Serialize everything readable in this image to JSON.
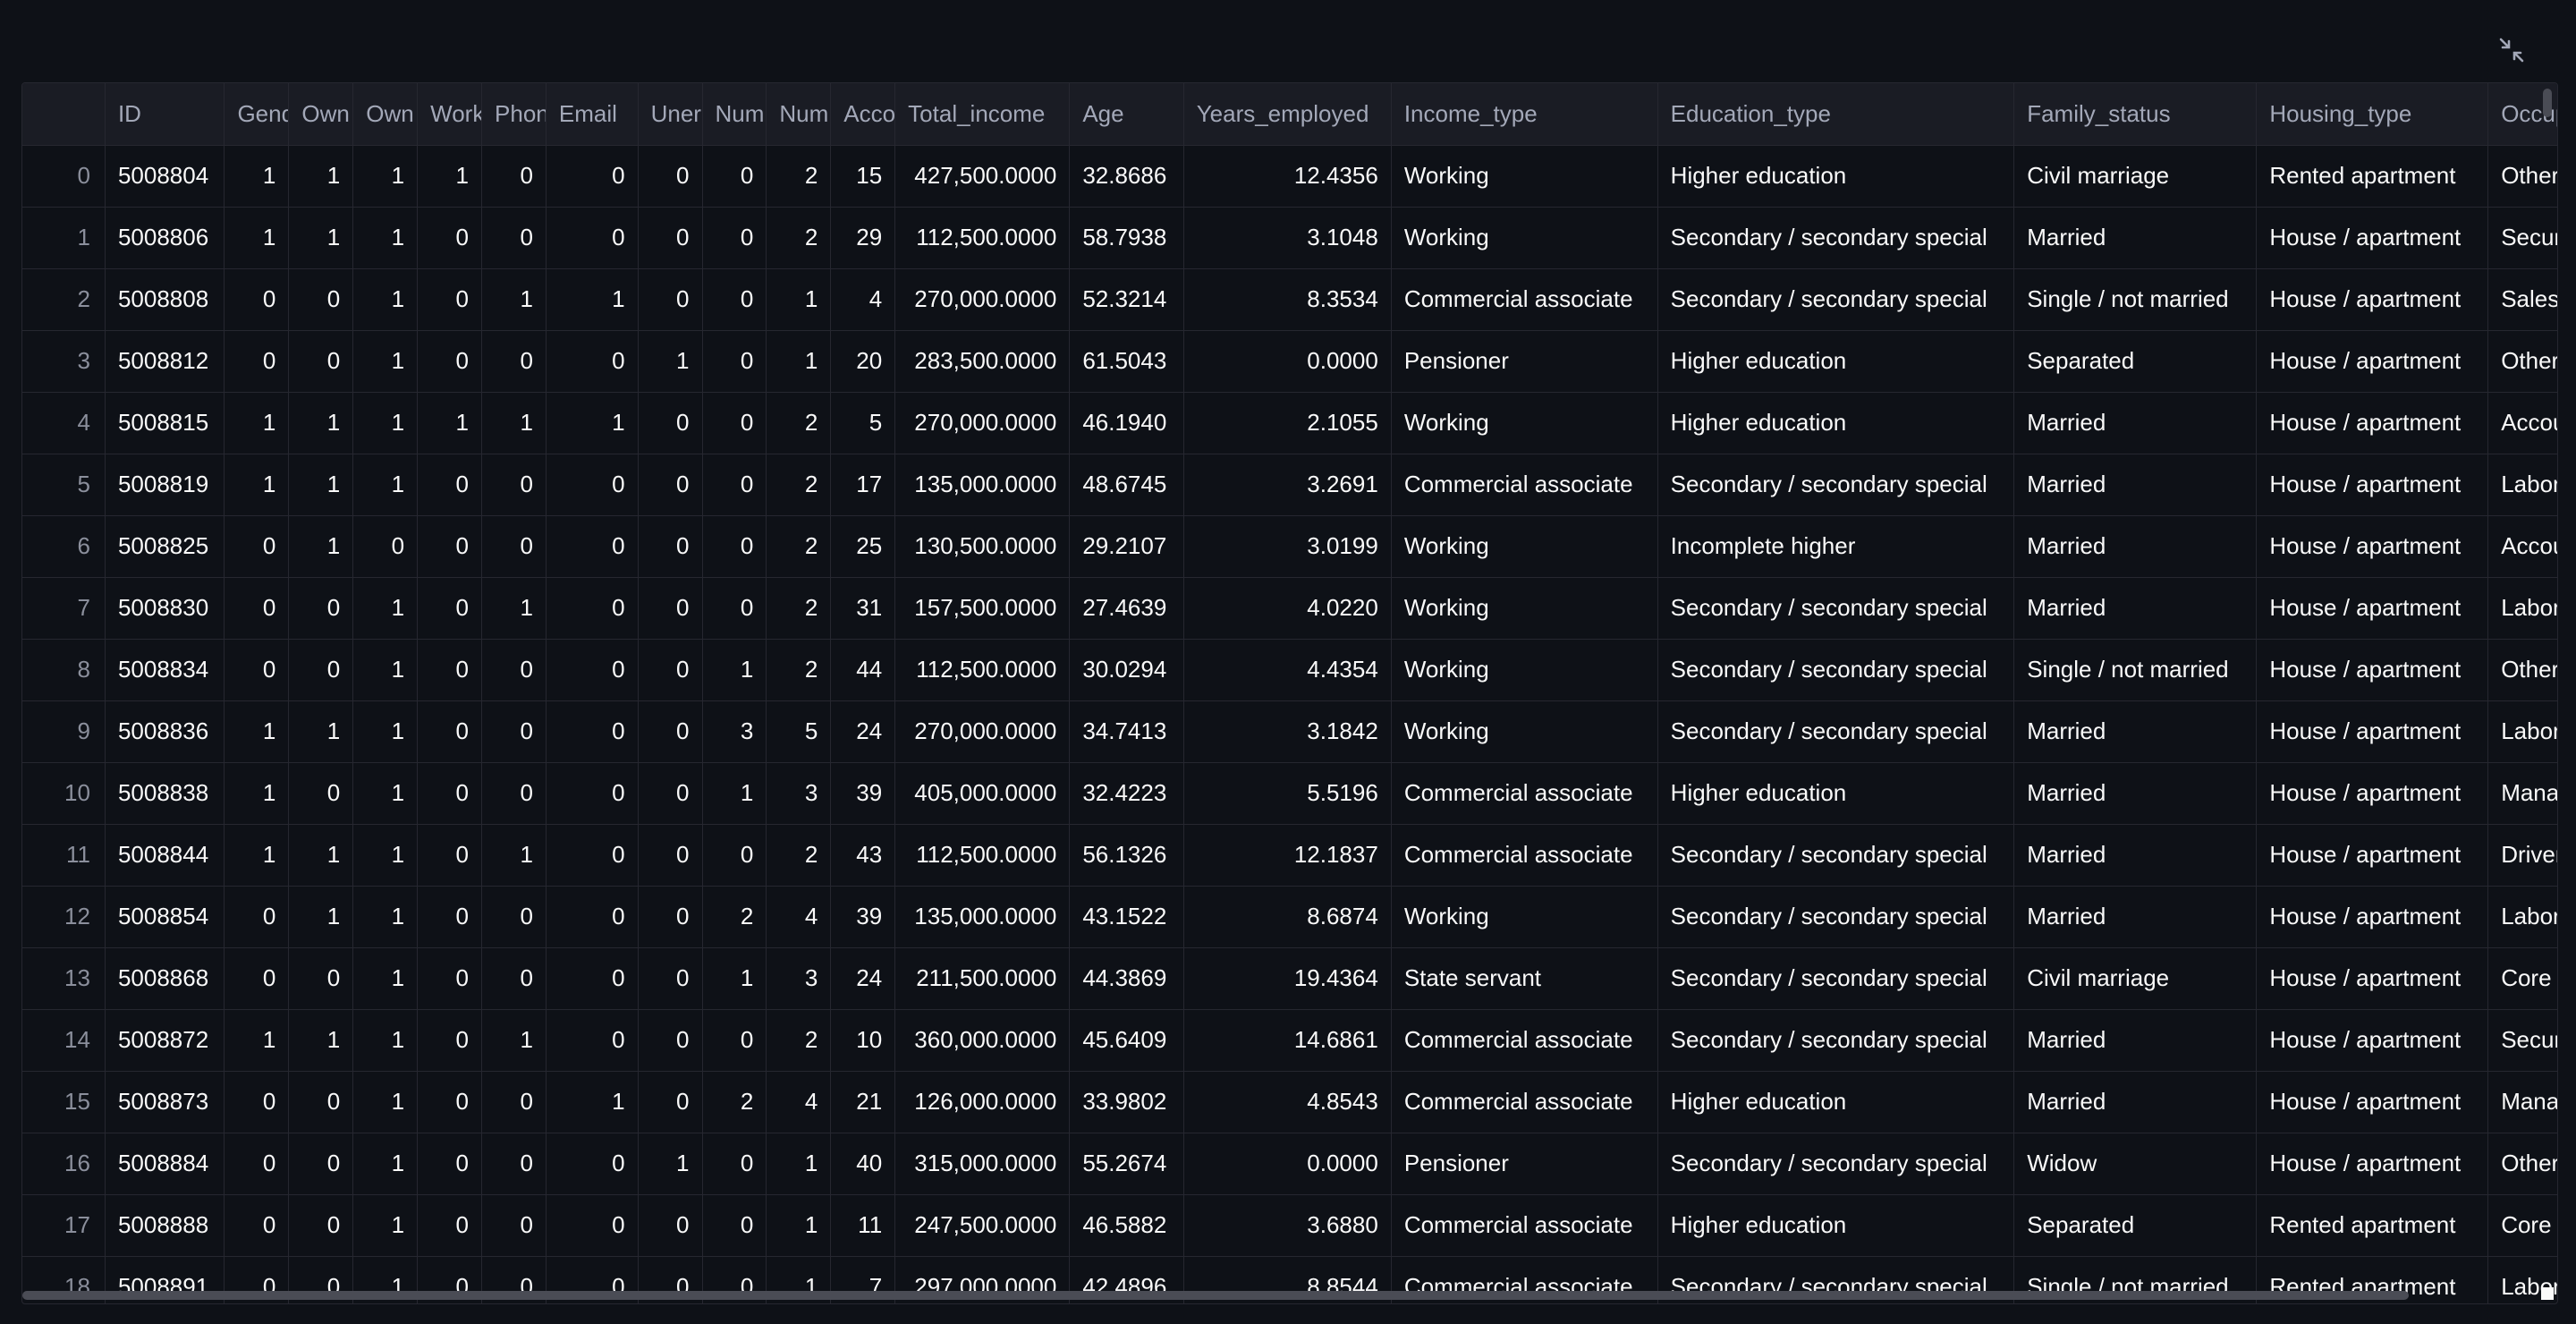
{
  "columns": [
    "",
    "ID",
    "Gend",
    "Own",
    "Own",
    "Work",
    "Phon",
    "Email",
    "Uner",
    "Num",
    "Num",
    "Acco",
    "Total_income",
    "Age",
    "Years_employed",
    "Income_type",
    "Education_type",
    "Family_status",
    "Housing_type",
    "Occupation"
  ],
  "rows": [
    [
      "0",
      "5008804",
      "1",
      "1",
      "1",
      "1",
      "0",
      "0",
      "0",
      "0",
      "2",
      "15",
      "427,500.0000",
      "32.8686",
      "12.4356",
      "Working",
      "Higher education",
      "Civil marriage",
      "Rented apartment",
      "Other"
    ],
    [
      "1",
      "5008806",
      "1",
      "1",
      "1",
      "0",
      "0",
      "0",
      "0",
      "0",
      "2",
      "29",
      "112,500.0000",
      "58.7938",
      "3.1048",
      "Working",
      "Secondary / secondary special",
      "Married",
      "House / apartment",
      "Security staff"
    ],
    [
      "2",
      "5008808",
      "0",
      "0",
      "1",
      "0",
      "1",
      "1",
      "0",
      "0",
      "1",
      "4",
      "270,000.0000",
      "52.3214",
      "8.3534",
      "Commercial associate",
      "Secondary / secondary special",
      "Single / not married",
      "House / apartment",
      "Sales staff"
    ],
    [
      "3",
      "5008812",
      "0",
      "0",
      "1",
      "0",
      "0",
      "0",
      "1",
      "0",
      "1",
      "20",
      "283,500.0000",
      "61.5043",
      "0.0000",
      "Pensioner",
      "Higher education",
      "Separated",
      "House / apartment",
      "Other"
    ],
    [
      "4",
      "5008815",
      "1",
      "1",
      "1",
      "1",
      "1",
      "1",
      "0",
      "0",
      "2",
      "5",
      "270,000.0000",
      "46.1940",
      "2.1055",
      "Working",
      "Higher education",
      "Married",
      "House / apartment",
      "Accountants"
    ],
    [
      "5",
      "5008819",
      "1",
      "1",
      "1",
      "0",
      "0",
      "0",
      "0",
      "0",
      "2",
      "17",
      "135,000.0000",
      "48.6745",
      "3.2691",
      "Commercial associate",
      "Secondary / secondary special",
      "Married",
      "House / apartment",
      "Laborers"
    ],
    [
      "6",
      "5008825",
      "0",
      "1",
      "0",
      "0",
      "0",
      "0",
      "0",
      "0",
      "2",
      "25",
      "130,500.0000",
      "29.2107",
      "3.0199",
      "Working",
      "Incomplete higher",
      "Married",
      "House / apartment",
      "Accountants"
    ],
    [
      "7",
      "5008830",
      "0",
      "0",
      "1",
      "0",
      "1",
      "0",
      "0",
      "0",
      "2",
      "31",
      "157,500.0000",
      "27.4639",
      "4.0220",
      "Working",
      "Secondary / secondary special",
      "Married",
      "House / apartment",
      "Laborers"
    ],
    [
      "8",
      "5008834",
      "0",
      "0",
      "1",
      "0",
      "0",
      "0",
      "0",
      "1",
      "2",
      "44",
      "112,500.0000",
      "30.0294",
      "4.4354",
      "Working",
      "Secondary / secondary special",
      "Single / not married",
      "House / apartment",
      "Other"
    ],
    [
      "9",
      "5008836",
      "1",
      "1",
      "1",
      "0",
      "0",
      "0",
      "0",
      "3",
      "5",
      "24",
      "270,000.0000",
      "34.7413",
      "3.1842",
      "Working",
      "Secondary / secondary special",
      "Married",
      "House / apartment",
      "Laborers"
    ],
    [
      "10",
      "5008838",
      "1",
      "0",
      "1",
      "0",
      "0",
      "0",
      "0",
      "1",
      "3",
      "39",
      "405,000.0000",
      "32.4223",
      "5.5196",
      "Commercial associate",
      "Higher education",
      "Married",
      "House / apartment",
      "Managers"
    ],
    [
      "11",
      "5008844",
      "1",
      "1",
      "1",
      "0",
      "1",
      "0",
      "0",
      "0",
      "2",
      "43",
      "112,500.0000",
      "56.1326",
      "12.1837",
      "Commercial associate",
      "Secondary / secondary special",
      "Married",
      "House / apartment",
      "Drivers"
    ],
    [
      "12",
      "5008854",
      "0",
      "1",
      "1",
      "0",
      "0",
      "0",
      "0",
      "2",
      "4",
      "39",
      "135,000.0000",
      "43.1522",
      "8.6874",
      "Working",
      "Secondary / secondary special",
      "Married",
      "House / apartment",
      "Laborers"
    ],
    [
      "13",
      "5008868",
      "0",
      "0",
      "1",
      "0",
      "0",
      "0",
      "0",
      "1",
      "3",
      "24",
      "211,500.0000",
      "44.3869",
      "19.4364",
      "State servant",
      "Secondary / secondary special",
      "Civil marriage",
      "House / apartment",
      "Core staff"
    ],
    [
      "14",
      "5008872",
      "1",
      "1",
      "1",
      "0",
      "1",
      "0",
      "0",
      "0",
      "2",
      "10",
      "360,000.0000",
      "45.6409",
      "14.6861",
      "Commercial associate",
      "Secondary / secondary special",
      "Married",
      "House / apartment",
      "Security staff"
    ],
    [
      "15",
      "5008873",
      "0",
      "0",
      "1",
      "0",
      "0",
      "1",
      "0",
      "2",
      "4",
      "21",
      "126,000.0000",
      "33.9802",
      "4.8543",
      "Commercial associate",
      "Higher education",
      "Married",
      "House / apartment",
      "Managers"
    ],
    [
      "16",
      "5008884",
      "0",
      "0",
      "1",
      "0",
      "0",
      "0",
      "1",
      "0",
      "1",
      "40",
      "315,000.0000",
      "55.2674",
      "0.0000",
      "Pensioner",
      "Secondary / secondary special",
      "Widow",
      "House / apartment",
      "Other"
    ],
    [
      "17",
      "5008888",
      "0",
      "0",
      "1",
      "0",
      "0",
      "0",
      "0",
      "0",
      "1",
      "11",
      "247,500.0000",
      "46.5882",
      "3.6880",
      "Commercial associate",
      "Higher education",
      "Separated",
      "Rented apartment",
      "Core staff"
    ],
    [
      "18",
      "5008891",
      "0",
      "0",
      "1",
      "0",
      "0",
      "0",
      "0",
      "0",
      "1",
      "7",
      "297,000.0000",
      "42.4896",
      "8.8544",
      "Commercial associate",
      "Secondary / secondary special",
      "Single / not married",
      "Rented apartment",
      "Laborers"
    ]
  ],
  "column_kinds": [
    "idx",
    "idcol",
    "num",
    "num",
    "num",
    "num",
    "num",
    "num",
    "num",
    "num",
    "num",
    "num",
    "num",
    "txt",
    "num",
    "txt",
    "txt",
    "txt",
    "txt",
    "txt"
  ],
  "icons": {
    "shrink": "exit-fullscreen-icon"
  },
  "colors": {
    "background": "#0e1117",
    "header": "#1a1c24",
    "border": "#262730",
    "text": "#fafafa",
    "muted": "#a3a8b8"
  }
}
